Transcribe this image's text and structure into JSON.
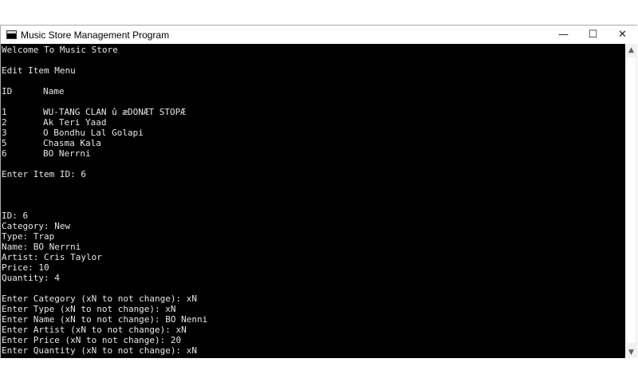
{
  "window": {
    "title": "Music Store Management Program",
    "minimize_glyph": "—",
    "maximize_glyph": "☐",
    "close_glyph": "✕"
  },
  "console": {
    "welcome": "Welcome To Music Store",
    "menu_title": "Edit Item Menu",
    "table": {
      "headers": [
        "ID",
        "Name"
      ],
      "rows": [
        {
          "id": "1",
          "name": "WU-TANG CLAN û æDONÆT STOPÆ"
        },
        {
          "id": "2",
          "name": "Ak Teri Yaad"
        },
        {
          "id": "3",
          "name": "O Bondhu Lal Golapi"
        },
        {
          "id": "5",
          "name": "Chasma Kala"
        },
        {
          "id": "6",
          "name": "BO Nerrni"
        }
      ]
    },
    "enter_id": "Enter Item ID: 6",
    "details": [
      "ID: 6",
      "Category: New",
      "Type: Trap",
      "Name: BO Nerrni",
      "Artist: Cris Taylor",
      "Price: 10",
      "Quantity: 4"
    ],
    "prompts": [
      "Enter Category (xN to not change): xN",
      "Enter Type (xN to not change): xN",
      "Enter Name (xN to not change): BO Nenni",
      "Enter Artist (xN to not change): xN",
      "Enter Price (xN to not change): 20",
      "Enter Quantity (xN to not change): xN"
    ]
  },
  "scrollbar": {
    "up_icon": "chevron-up",
    "down_icon": "chevron-down",
    "up_glyph": "▲",
    "down_glyph": "▼"
  }
}
